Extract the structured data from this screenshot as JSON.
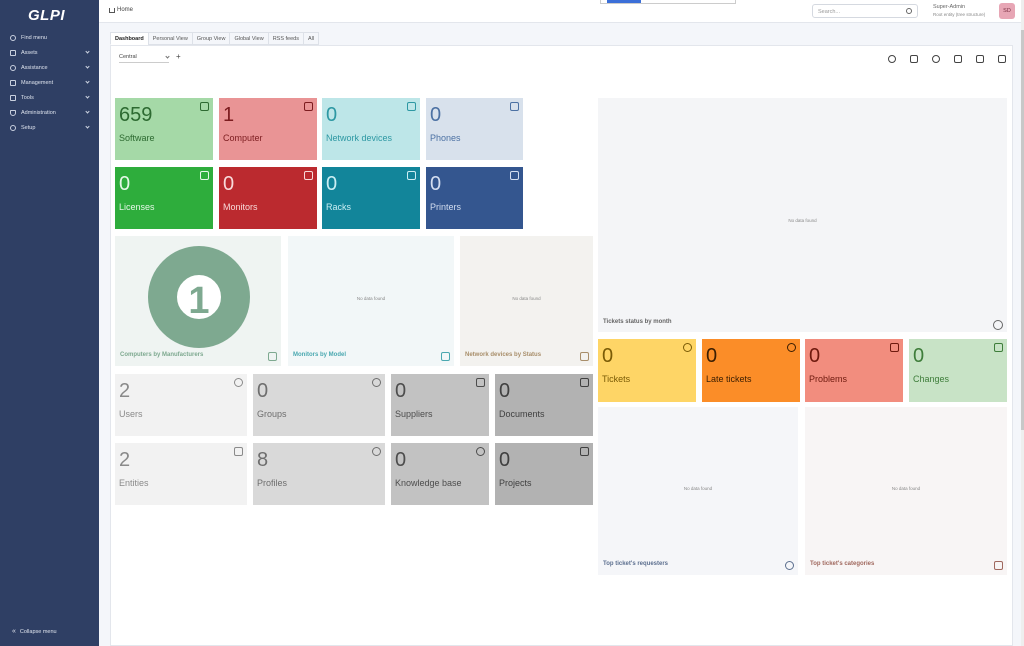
{
  "app": {
    "logo": "GLPI"
  },
  "sidebar": {
    "items": [
      {
        "label": "Find menu",
        "icon": "search-icon",
        "has_chevron": false
      },
      {
        "label": "Assets",
        "icon": "box-icon",
        "has_chevron": true
      },
      {
        "label": "Assistance",
        "icon": "headset-icon",
        "has_chevron": true
      },
      {
        "label": "Management",
        "icon": "wallet-icon",
        "has_chevron": true
      },
      {
        "label": "Tools",
        "icon": "briefcase-icon",
        "has_chevron": true
      },
      {
        "label": "Administration",
        "icon": "shield-icon",
        "has_chevron": true
      },
      {
        "label": "Setup",
        "icon": "gear-icon",
        "has_chevron": true
      }
    ],
    "collapse_label": "Collapse menu"
  },
  "header": {
    "breadcrumb": "Home",
    "search_placeholder": "Search...",
    "user_name": "Super-Admin",
    "user_entity": "Root entity (tree structure)",
    "avatar_initials": "SD"
  },
  "tabs": [
    {
      "label": "Dashboard",
      "active": true
    },
    {
      "label": "Personal View",
      "active": false
    },
    {
      "label": "Group View",
      "active": false
    },
    {
      "label": "Global View",
      "active": false
    },
    {
      "label": "RSS feeds",
      "active": false
    },
    {
      "label": "All",
      "active": false
    }
  ],
  "dashboard": {
    "selector_value": "Central",
    "add_label": "+"
  },
  "cards": {
    "software": {
      "value": "659",
      "label": "Software",
      "icon": "apps-icon"
    },
    "computer": {
      "value": "1",
      "label": "Computer",
      "icon": "laptop-icon"
    },
    "network": {
      "value": "0",
      "label": "Network devices",
      "icon": "network-icon"
    },
    "phones": {
      "value": "0",
      "label": "Phones",
      "icon": "phone-icon"
    },
    "licenses": {
      "value": "0",
      "label": "Licenses",
      "icon": "key-icon"
    },
    "monitors": {
      "value": "0",
      "label": "Monitors",
      "icon": "monitor-icon"
    },
    "racks": {
      "value": "0",
      "label": "Racks",
      "icon": "server-icon"
    },
    "printers": {
      "value": "0",
      "label": "Printers",
      "icon": "printer-icon"
    },
    "users": {
      "value": "2",
      "label": "Users",
      "icon": "user-icon"
    },
    "groups": {
      "value": "0",
      "label": "Groups",
      "icon": "users-icon"
    },
    "suppliers": {
      "value": "0",
      "label": "Suppliers",
      "icon": "dolly-icon"
    },
    "documents": {
      "value": "0",
      "label": "Documents",
      "icon": "files-icon"
    },
    "entities": {
      "value": "2",
      "label": "Entities",
      "icon": "layers-icon"
    },
    "profiles": {
      "value": "8",
      "label": "Profiles",
      "icon": "user-check-icon"
    },
    "kb": {
      "value": "0",
      "label": "Knowledge base",
      "icon": "lifebuoy-icon"
    },
    "projects": {
      "value": "0",
      "label": "Projects",
      "icon": "columns-icon"
    },
    "tickets": {
      "value": "0",
      "label": "Tickets",
      "icon": "alert-circle-icon"
    },
    "late": {
      "value": "0",
      "label": "Late tickets",
      "icon": "clock-icon"
    },
    "problems": {
      "value": "0",
      "label": "Problems",
      "icon": "alert-triangle-icon"
    },
    "changes": {
      "value": "0",
      "label": "Changes",
      "icon": "clipboard-check-icon"
    }
  },
  "widgets": {
    "computers_by_manufacturer": {
      "title": "Computers by Manufacturers",
      "value": "1"
    },
    "monitors_by_model": {
      "title": "Monitors by Model",
      "no_data": "No data found"
    },
    "network_by_status": {
      "title": "Network devices by Status",
      "no_data": "No data found"
    },
    "tickets_status_month": {
      "title": "Tickets status by month",
      "no_data": "No data found"
    },
    "top_requesters": {
      "title": "Top ticket's requesters",
      "no_data": "No data found"
    },
    "top_categories": {
      "title": "Top ticket's categories",
      "no_data": "No data found"
    }
  },
  "colors": {
    "sidebar": "#2f3f64",
    "software": "#a5d9a7",
    "computer": "#e99495",
    "network": "#bde6e8",
    "phones": "#d8e1ec",
    "licenses": "#2ead3c",
    "monitors": "#bb2a2f",
    "racks": "#12859a",
    "printers": "#34568f",
    "tickets": "#fed566",
    "late": "#fb8d28",
    "problems": "#f28d7e",
    "changes": "#c8e3c6"
  }
}
